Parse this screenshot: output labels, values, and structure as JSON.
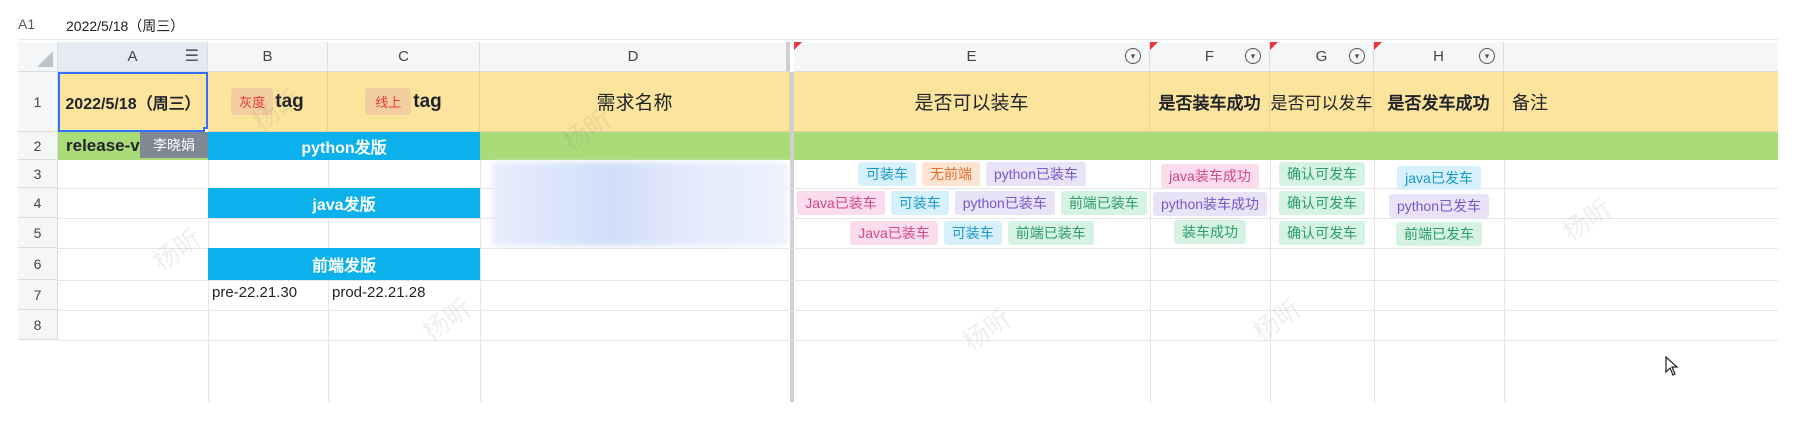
{
  "formula_bar": {
    "cell_ref": "A1",
    "value": "2022/5/18（周三）"
  },
  "columns": [
    "A",
    "B",
    "C",
    "D",
    "E",
    "F",
    "G",
    "H"
  ],
  "rows": [
    "1",
    "2",
    "3",
    "4",
    "5",
    "6",
    "7",
    "8"
  ],
  "header": {
    "a1": "2022/5/18（周三）",
    "b1_badge": "灰度",
    "b1_suffix": "tag",
    "c1_badge": "线上",
    "c1_suffix": "tag",
    "d1": "需求名称",
    "e1": "是否可以装车",
    "f1": "是否装车成功",
    "g1": "是否可以发车",
    "h1": "是否发车成功",
    "i1": "备注"
  },
  "row2": {
    "release_text": "release-v",
    "collaborator": "李晓娟",
    "python_band": "python发版"
  },
  "row4": {
    "java_band": "java发版"
  },
  "row6": {
    "frontend_band": "前端发版"
  },
  "row7": {
    "b7": "pre-22.21.30",
    "c7": "prod-22.21.28"
  },
  "e_tags": {
    "r3": [
      "可装车",
      "无前端",
      "python已装车"
    ],
    "r4": [
      "Java已装车",
      "可装车",
      "python已装车",
      "前端已装车"
    ],
    "r5": [
      "Java已装车",
      "可装车",
      "前端已装车"
    ]
  },
  "f_tags": [
    "java装车成功",
    "python装车成功",
    "装车成功"
  ],
  "g_tags": [
    "确认可发车",
    "确认可发车",
    "确认可发车"
  ],
  "h_tags": [
    "java已发车",
    "python已发车",
    "前端已发车"
  ],
  "watermark": "杨昕",
  "colors": {
    "header_yellow": "#fce49d",
    "green_band": "#a9db78",
    "blue_band": "#0cb1eb",
    "red_badge": "#e8373b"
  }
}
